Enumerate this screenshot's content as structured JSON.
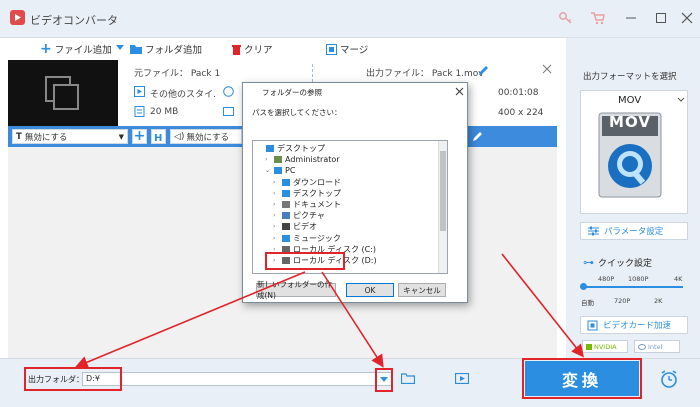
{
  "app": {
    "title": "ビデオコンバータ"
  },
  "toolbar": {
    "add_file": "ファイル追加",
    "add_folder": "フォルダ追加",
    "clear": "クリア",
    "merge": "マージ"
  },
  "file_item": {
    "source_label": "元ファイル：",
    "source_name": "Pack 1",
    "other_style": "その他のスタイ.",
    "size": "20 MB",
    "output_label": "出力ファイル：",
    "output_name": "Pack 1.mov",
    "duration": "00:01:08",
    "resolution": "400 x 224"
  },
  "subtitle_bar": {
    "subtitle_select": "無効にする",
    "audio_select": "無効にする"
  },
  "right_panel": {
    "title": "出力フォーマットを選択",
    "format": "MOV",
    "format_icon_text": "MOV",
    "param_button": "パラメータ設定",
    "quick_label": "クイック設定",
    "res_top": [
      "480P",
      "1080P",
      "4K"
    ],
    "res_bottom": [
      "自動",
      "720P",
      "2K"
    ],
    "gpu_label": "ビデオカード加速",
    "nvidia": "NVIDIA",
    "intel": "Intel"
  },
  "bottom": {
    "output_folder_label": "出力フォルダ：",
    "output_folder_value": "D:¥",
    "convert_label": "変換"
  },
  "dialog": {
    "title": "フォルダーの参照",
    "prompt": "パスを選択してください：",
    "tree": [
      {
        "label": "デスクトップ",
        "level": 0,
        "icon": "desktop-folder-icon"
      },
      {
        "label": "Administrator",
        "level": 1,
        "icon": "user-icon"
      },
      {
        "label": "PC",
        "level": 1,
        "icon": "pc-icon"
      },
      {
        "label": "ダウンロード",
        "level": 2,
        "icon": "download-icon"
      },
      {
        "label": "デスクトップ",
        "level": 2,
        "icon": "desktop-icon"
      },
      {
        "label": "ドキュメント",
        "level": 2,
        "icon": "documents-icon"
      },
      {
        "label": "ピクチャ",
        "level": 2,
        "icon": "pictures-icon"
      },
      {
        "label": "ビデオ",
        "level": 2,
        "icon": "videos-icon"
      },
      {
        "label": "ミュージック",
        "level": 2,
        "icon": "music-icon"
      },
      {
        "label": "ローカル ディスク (C:)",
        "level": 2,
        "icon": "drive-icon"
      },
      {
        "label": "ローカル ディスク (D:)",
        "level": 2,
        "icon": "drive-icon"
      }
    ],
    "new_folder": "新しいフォルダーの作成(N)",
    "ok": "OK",
    "cancel": "キャンセル"
  },
  "colors": {
    "accent_blue": "#2b8ee0",
    "highlight_red": "#e0242a",
    "panel_bg": "#e9eff6"
  }
}
